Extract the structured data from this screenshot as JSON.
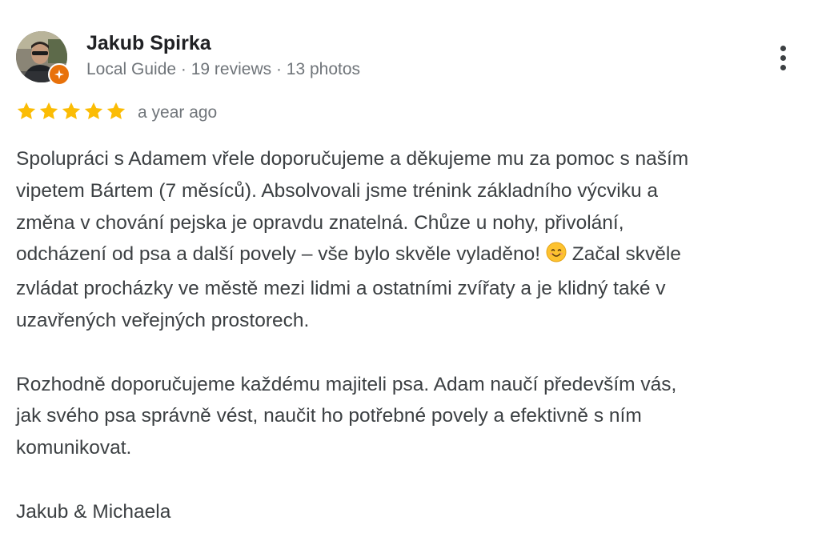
{
  "reviewer": {
    "name": "Jakub Spirka",
    "meta": "Local Guide · 19 reviews · 13 photos"
  },
  "rating": {
    "stars": 5,
    "max": 5,
    "star_color": "#fbbc04",
    "time": "a year ago"
  },
  "review": {
    "lines": [
      "Spolupráci s Adamem vřele doporučujeme a děkujeme mu za pomoc s naším",
      "vipetem Bártem (7 měsíců). Absolvovali jsme trénink základního výcviku a",
      "změna v chování pejska je opravdu znatelná. Chůze u nohy, přivolání,"
    ],
    "line4_before_emoji": "odcházení od psa a další povely – vše bylo skvěle vyladěno! ",
    "line4_after_emoji": " Začal skvěle",
    "lines_b": [
      "zvládat procházky ve městě mezi lidmi a ostatními zvířaty a je klidný také v",
      "uzavřených veřejných prostorech."
    ],
    "para2": [
      "Rozhodně doporučujeme každému majiteli psa. Adam naučí především vás,",
      "jak svého psa správně vést, naučit ho potřebné povely a efektivně s ním",
      "komunikovat."
    ],
    "signature": "Jakub & Michaela"
  },
  "icons": {
    "more": "more-vert-icon",
    "badge": "local-guide-badge-icon",
    "emoji": "smiling-face-emoji"
  },
  "colors": {
    "name": "#202124",
    "secondary": "#70757a",
    "body": "#3c4043",
    "badge": "#e8710a"
  }
}
